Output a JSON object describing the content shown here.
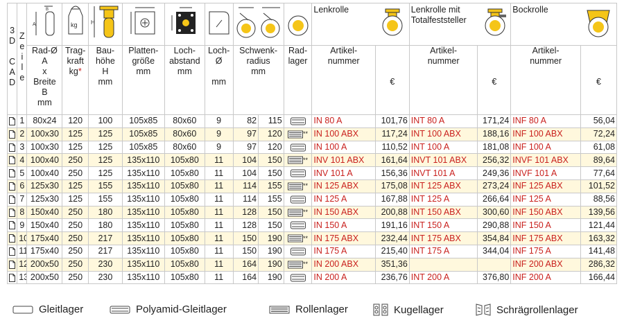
{
  "header": {
    "col_3dcad": "3 D C A D",
    "col_zeile": "Z e i l e",
    "rad": [
      "Rad-Ø",
      "A",
      "x",
      "Breite",
      "B",
      "mm"
    ],
    "tragkraft": [
      "Trag-",
      "kraft",
      "kg"
    ],
    "tragkraft_star": "*",
    "bauhoehe": [
      "Bau-",
      "höhe",
      "H",
      "mm"
    ],
    "platte": [
      "Platten-",
      "größe",
      "mm"
    ],
    "lochabstand": [
      "Loch-",
      "abstand",
      "mm"
    ],
    "lochd": [
      "Loch-",
      "Ø",
      "",
      "mm"
    ],
    "schwenk": [
      "Schwenk-",
      "radius",
      "mm"
    ],
    "radlager": [
      "Rad-",
      "lager"
    ],
    "lenkrolle_title": "Lenkrolle",
    "lenkrolle_fest_title": [
      "Lenkrolle mit",
      "Totalfeststeller"
    ],
    "bockrolle_title": "Bockrolle",
    "artikel": [
      "Artikel-",
      "nummer"
    ],
    "euro": "€",
    "icon_kg": "kg"
  },
  "rows": [
    {
      "z": "1",
      "rad": "80x24",
      "kg": "120",
      "h": "100",
      "pl": "105x85",
      "la": "80x60",
      "ld": "9",
      "s1": "82",
      "s2": "115",
      "lager": "polyamide",
      "stars": "",
      "a1": "IN 80 A",
      "p1": "101,76",
      "a2": "INT 80 A",
      "p2": "171,24",
      "a3": "INF 80 A",
      "p3": "56,04"
    },
    {
      "z": "2",
      "rad": "100x30",
      "kg": "125",
      "h": "125",
      "pl": "105x85",
      "la": "80x60",
      "ld": "9",
      "s1": "97",
      "s2": "120",
      "lager": "roller",
      "stars": "**",
      "a1": "IN 100 ABX",
      "p1": "117,24",
      "a2": "INT 100 ABX",
      "p2": "188,16",
      "a3": "INF 100 ABX",
      "p3": "72,24"
    },
    {
      "z": "3",
      "rad": "100x30",
      "kg": "125",
      "h": "125",
      "pl": "105x85",
      "la": "80x60",
      "ld": "9",
      "s1": "97",
      "s2": "120",
      "lager": "polyamide",
      "stars": "",
      "a1": "IN 100 A",
      "p1": "110,52",
      "a2": "INT 100 A",
      "p2": "181,08",
      "a3": "INF 100 A",
      "p3": "61,08"
    },
    {
      "z": "4",
      "rad": "100x40",
      "kg": "250",
      "h": "125",
      "pl": "135x110",
      "la": "105x80",
      "ld": "11",
      "s1": "104",
      "s2": "150",
      "lager": "roller",
      "stars": "**",
      "a1": "INV 101 ABX",
      "p1": "161,64",
      "a2": "INVT 101 ABX",
      "p2": "256,32",
      "a3": "INVF 101 ABX",
      "p3": "89,64"
    },
    {
      "z": "5",
      "rad": "100x40",
      "kg": "250",
      "h": "125",
      "pl": "135x110",
      "la": "105x80",
      "ld": "11",
      "s1": "104",
      "s2": "150",
      "lager": "polyamide",
      "stars": "",
      "a1": "INV 101 A",
      "p1": "156,36",
      "a2": "INVT 101 A",
      "p2": "249,36",
      "a3": "INVF 101 A",
      "p3": "77,64"
    },
    {
      "z": "6",
      "rad": "125x30",
      "kg": "125",
      "h": "155",
      "pl": "135x110",
      "la": "105x80",
      "ld": "11",
      "s1": "114",
      "s2": "155",
      "lager": "roller",
      "stars": "**",
      "a1": "IN 125 ABX",
      "p1": "175,08",
      "a2": "INT 125 ABX",
      "p2": "273,24",
      "a3": "INF 125 ABX",
      "p3": "101,52"
    },
    {
      "z": "7",
      "rad": "125x30",
      "kg": "125",
      "h": "155",
      "pl": "135x110",
      "la": "105x80",
      "ld": "11",
      "s1": "114",
      "s2": "155",
      "lager": "polyamide",
      "stars": "",
      "a1": "IN 125 A",
      "p1": "167,88",
      "a2": "INT 125 A",
      "p2": "266,64",
      "a3": "INF 125 A",
      "p3": "88,56"
    },
    {
      "z": "8",
      "rad": "150x40",
      "kg": "250",
      "h": "180",
      "pl": "135x110",
      "la": "105x80",
      "ld": "11",
      "s1": "128",
      "s2": "150",
      "lager": "roller",
      "stars": "**",
      "a1": "IN 150 ABX",
      "p1": "200,88",
      "a2": "INT 150 ABX",
      "p2": "300,60",
      "a3": "INF 150 ABX",
      "p3": "139,56"
    },
    {
      "z": "9",
      "rad": "150x40",
      "kg": "250",
      "h": "180",
      "pl": "135x110",
      "la": "105x80",
      "ld": "11",
      "s1": "128",
      "s2": "150",
      "lager": "polyamide",
      "stars": "",
      "a1": "IN 150 A",
      "p1": "191,16",
      "a2": "INT 150 A",
      "p2": "290,88",
      "a3": "INF 150 A",
      "p3": "121,44"
    },
    {
      "z": "10",
      "rad": "175x40",
      "kg": "250",
      "h": "217",
      "pl": "135x110",
      "la": "105x80",
      "ld": "11",
      "s1": "150",
      "s2": "190",
      "lager": "roller",
      "stars": "**",
      "a1": "IN 175 ABX",
      "p1": "232,44",
      "a2": "INT 175 ABX",
      "p2": "354,84",
      "a3": "INF 175 ABX",
      "p3": "163,32"
    },
    {
      "z": "11",
      "rad": "175x40",
      "kg": "250",
      "h": "217",
      "pl": "135x110",
      "la": "105x80",
      "ld": "11",
      "s1": "150",
      "s2": "190",
      "lager": "polyamide",
      "stars": "",
      "a1": "IN 175 A",
      "p1": "215,40",
      "a2": "INT 175 A",
      "p2": "344,04",
      "a3": "INF 175 A",
      "p3": "141,48"
    },
    {
      "z": "12",
      "rad": "200x50",
      "kg": "250",
      "h": "230",
      "pl": "135x110",
      "la": "105x80",
      "ld": "11",
      "s1": "164",
      "s2": "190",
      "lager": "roller",
      "stars": "**",
      "a1": "IN 200 ABX",
      "p1": "351,36",
      "a2": "",
      "p2": "",
      "a3": "INF 200 ABX",
      "p3": "286,32"
    },
    {
      "z": "13",
      "rad": "200x50",
      "kg": "250",
      "h": "230",
      "pl": "135x110",
      "la": "105x80",
      "ld": "11",
      "s1": "164",
      "s2": "190",
      "lager": "polyamide",
      "stars": "",
      "a1": "IN 200 A",
      "p1": "236,76",
      "a2": "INT 200 A",
      "p2": "376,80",
      "a3": "INF 200 A",
      "p3": "166,44"
    }
  ],
  "legend": {
    "gleit": "Gleitlager",
    "polyamid": "Polyamid-Gleitlager",
    "rollen": "Rollenlager",
    "kugel": "Kugellager",
    "schraeg": "Schrägrollenlager"
  },
  "colors": {
    "red": "#c9211e",
    "yellow": "#f5c518",
    "row_alt": "#fff8dd"
  }
}
